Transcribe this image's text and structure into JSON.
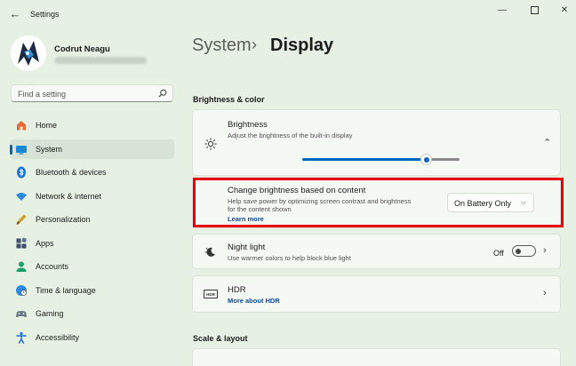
{
  "window": {
    "title": "Settings"
  },
  "profile": {
    "name": "Codrut Neagu"
  },
  "search": {
    "placeholder": "Find a setting"
  },
  "nav": {
    "items": [
      {
        "label": "Home",
        "icon": "home-icon"
      },
      {
        "label": "System",
        "icon": "system-icon"
      },
      {
        "label": "Bluetooth & devices",
        "icon": "bluetooth-icon"
      },
      {
        "label": "Network & internet",
        "icon": "wifi-icon"
      },
      {
        "label": "Personalization",
        "icon": "brush-icon"
      },
      {
        "label": "Apps",
        "icon": "apps-icon"
      },
      {
        "label": "Accounts",
        "icon": "accounts-icon"
      },
      {
        "label": "Time & language",
        "icon": "globe-icon"
      },
      {
        "label": "Gaming",
        "icon": "gamepad-icon"
      },
      {
        "label": "Accessibility",
        "icon": "accessibility-icon"
      }
    ],
    "selected": "System"
  },
  "breadcrumb": {
    "parent": "System",
    "separator": "›",
    "current": "Display"
  },
  "brightness_color": {
    "heading": "Brightness & color",
    "brightness": {
      "title": "Brightness",
      "description": "Adjust the brightness of the built-in display",
      "level_percent": 79
    },
    "content_brightness": {
      "title": "Change brightness based on content",
      "description_line1": "Help save power by optimizing screen contrast and brightness",
      "description_line2": "for the content shown",
      "link": "Learn more",
      "value": "On Battery Only"
    },
    "night_light": {
      "title": "Night light",
      "description": "Use warmer colors to help block blue light",
      "state": "Off"
    },
    "hdr": {
      "title": "HDR",
      "link": "More about HDR",
      "icon_text": "HDR"
    }
  },
  "scale_layout": {
    "heading": "Scale & layout"
  },
  "colors": {
    "accent": "#0067c0",
    "highlight": "#e8000b"
  }
}
